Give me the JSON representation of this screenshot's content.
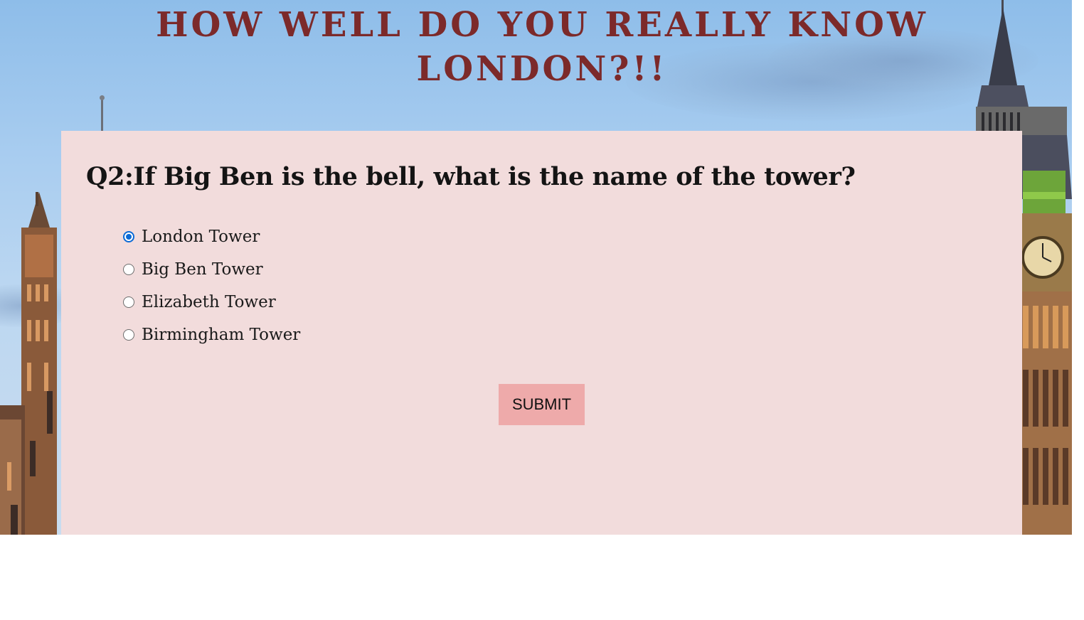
{
  "page": {
    "title_line1": "HOW WELL DO YOU REALLY KNOW",
    "title_line2": "LONDON?!!"
  },
  "quiz": {
    "question": "Q2:If Big Ben is the bell, what is the name of the tower?",
    "options": [
      {
        "label": "London Tower",
        "selected": true
      },
      {
        "label": "Big Ben Tower",
        "selected": false
      },
      {
        "label": "Elizabeth Tower",
        "selected": false
      },
      {
        "label": "Birmingham Tower",
        "selected": false
      }
    ],
    "submit_label": "SUBMIT"
  },
  "colors": {
    "title": "#7c2a2a",
    "card_background": "#f2dcdc",
    "submit_background": "#eeaaaa",
    "radio_selected": "#0b6ad6"
  }
}
